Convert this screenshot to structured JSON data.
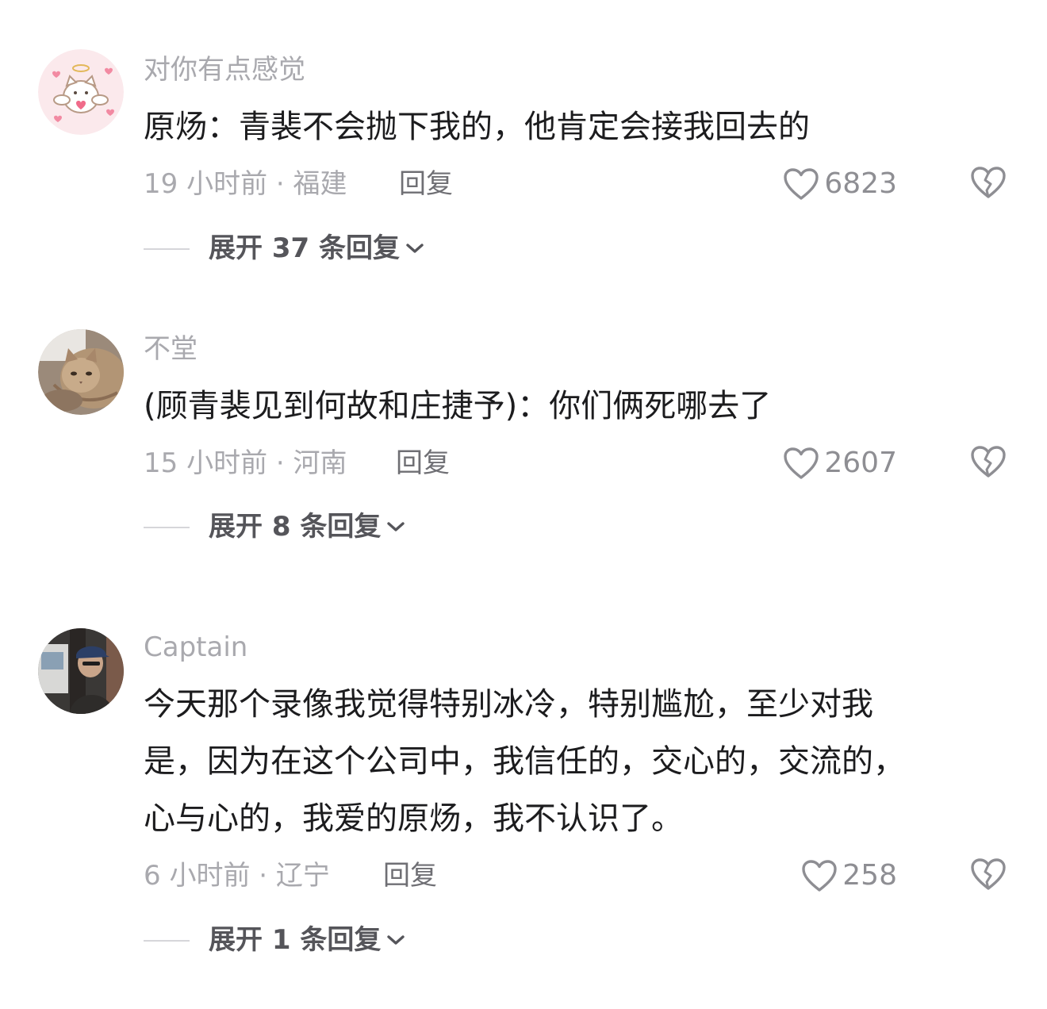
{
  "comments": [
    {
      "username": "对你有点感觉",
      "avatar_icon": "angel-cat-sticker-avatar",
      "text_lines": [
        "原炀：青裴不会抛下我的，他肯定会接我回去的"
      ],
      "meta": "19 小时前 · 福建",
      "reply_label": "回复",
      "likes": "6823",
      "expand_label": "展开 37 条回复"
    },
    {
      "username": "不堂",
      "avatar_icon": "cat-photo-avatar",
      "text_lines": [
        "(顾青裴见到何故和庄捷予)：你们俩死哪去了"
      ],
      "meta": "15 小时前 · 河南",
      "reply_label": "回复",
      "likes": "2607",
      "expand_label": "展开 8 条回复"
    },
    {
      "username": "Captain",
      "avatar_icon": "person-cap-photo-avatar",
      "text_lines": [
        "今天那个录像我觉得特别冰冷，特别尴尬，至少对我",
        "是，因为在这个公司中，我信任的，交心的，交流的，",
        "心与心的，我爱的原炀，我不认识了。"
      ],
      "meta": "6 小时前 · 辽宁",
      "reply_label": "回复",
      "likes": "258",
      "expand_label": "展开 1 条回复"
    }
  ],
  "icons": {
    "like": "heart-outline-icon",
    "dislike": "broken-heart-icon",
    "expand": "chevron-down-icon"
  },
  "colors": {
    "username": "#a9a9ae",
    "meta": "#a9a9ae",
    "reply": "#6f6f74",
    "text": "#1c1c1e",
    "expand": "#55555a",
    "like_icon": "#8e8e93"
  }
}
